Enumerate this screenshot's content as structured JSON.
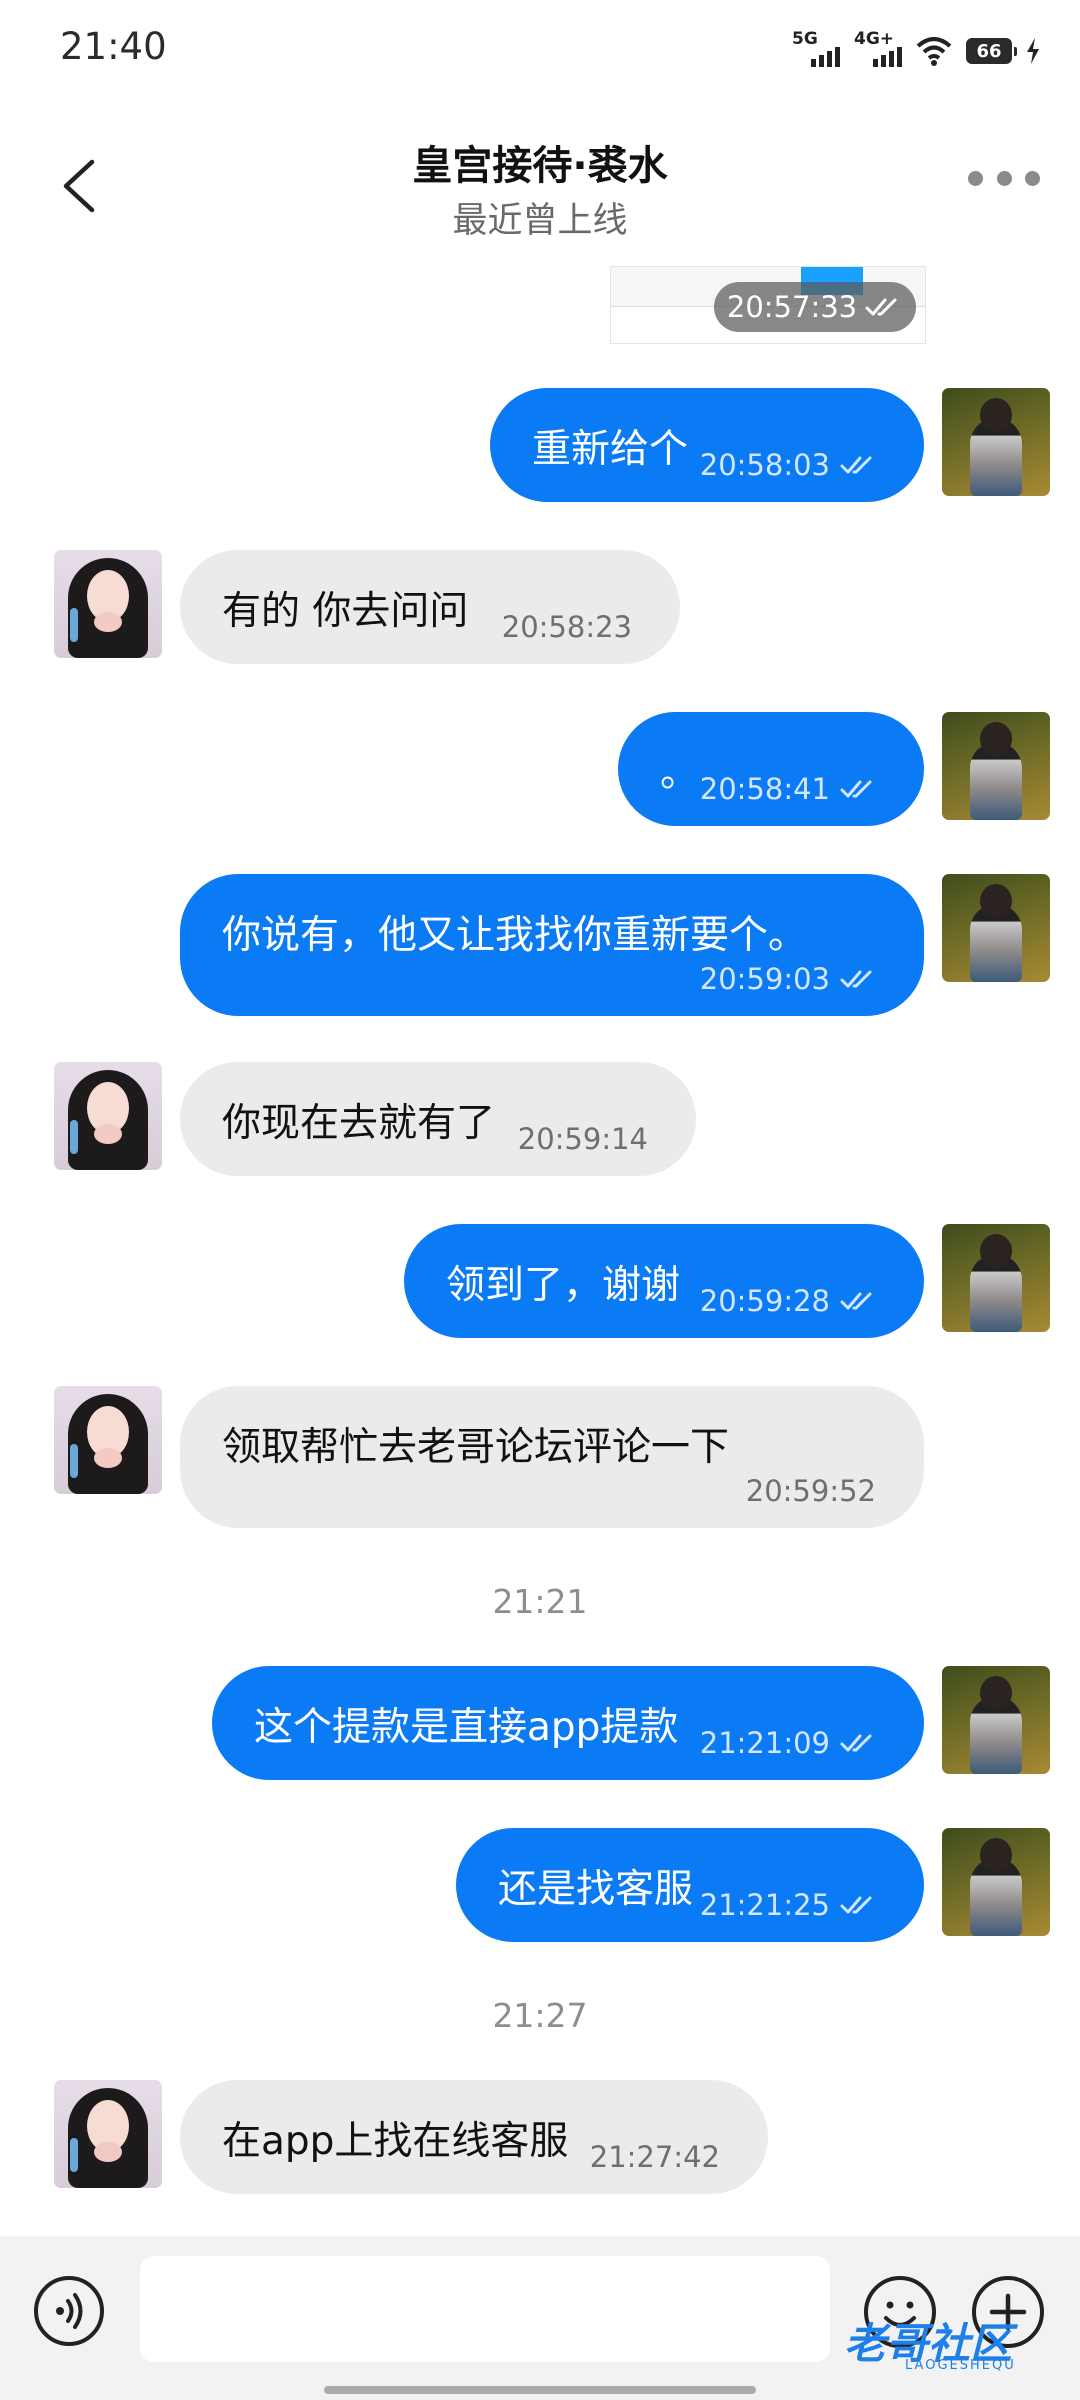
{
  "status_bar": {
    "time": "21:40",
    "net1": "5G",
    "net2": "4G+",
    "battery": "66"
  },
  "header": {
    "title": "皇宫接待·裘水",
    "subtitle": "最近曾上线"
  },
  "image_message": {
    "time": "20:57:33"
  },
  "messages": [
    {
      "side": "out",
      "text": "重新给个",
      "time": "20:58:03",
      "read": true
    },
    {
      "side": "in",
      "text": "有的  你去问问",
      "time": "20:58:23"
    },
    {
      "side": "out",
      "text": "。",
      "time": "20:58:41",
      "read": true
    },
    {
      "side": "out",
      "text": "你说有，他又让我找你重新要个。",
      "time": "20:59:03",
      "read": true
    },
    {
      "side": "in",
      "text": "你现在去就有了",
      "time": "20:59:14"
    },
    {
      "side": "out",
      "text": "领到了，谢谢",
      "time": "20:59:28",
      "read": true
    },
    {
      "side": "in",
      "text": "领取帮忙去老哥论坛评论一下",
      "time": "20:59:52"
    },
    {
      "side": "out",
      "text": "这个提款是直接app提款",
      "time": "21:21:09",
      "read": true
    },
    {
      "side": "out",
      "text": "还是找客服",
      "time": "21:21:25",
      "read": true
    },
    {
      "side": "in",
      "text": "在app上找在线客服",
      "time": "21:27:42"
    }
  ],
  "separators": [
    "21:21",
    "21:27"
  ],
  "input": {
    "placeholder": ""
  },
  "watermark": {
    "text": "老哥社区",
    "sub": "LAOGESHEQU"
  },
  "colors": {
    "outgoing_bubble": "#0b7bf5",
    "incoming_bubble": "#ebebeb"
  }
}
